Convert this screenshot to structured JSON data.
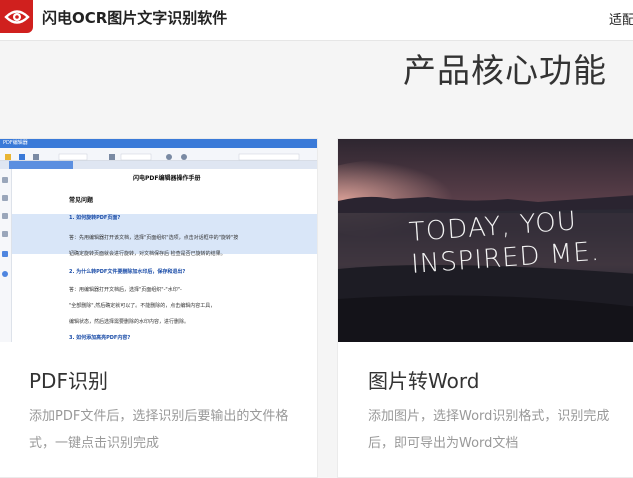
{
  "header": {
    "app_name": "闪电OCR图片文字识别软件",
    "nav_item": "适配"
  },
  "section": {
    "title": "产品核心功能"
  },
  "cards": [
    {
      "title": "PDF识别",
      "description": "添加PDF文件后，选择识别后要输出的文件格式，一键点击识别完成",
      "image": {
        "window_title": "PDF编辑器",
        "doc_title": "闪电PDF编辑器操作手册",
        "doc_heading": "常见问题",
        "lines": [
          "1. 如何旋转PDF页面?",
          "答：先用编辑器打开该文档，选择\"页面组织\"选项，点击对话框中的\"旋转\"按",
          "钮确定旋转页面就会进行旋转，对文档保存后 检查是否已旋转的结果。",
          "2. 为什么转PDF文件要删除加水印后，保存和退出?",
          "答：用编辑器打开文档后，选择\"页面组织\"-\"水印\"-",
          "\"全部删除\",然后确定就可以了。不能删除的，点击编辑内容工具，",
          "编辑状态，然后选择需要删除的水印内容，进行删除。",
          "3. 如何添加高亮PDF内容?"
        ]
      }
    },
    {
      "title": "图片转Word",
      "description": "添加图片，选择Word识别格式，识别完成后，即可导出为Word文档",
      "image": {
        "line1": "TODAY, YOU",
        "line2": "INSPIRED ME."
      }
    }
  ],
  "colors": {
    "brand_red": "#d0201e",
    "title_text": "#333333",
    "muted_text": "#999999"
  }
}
